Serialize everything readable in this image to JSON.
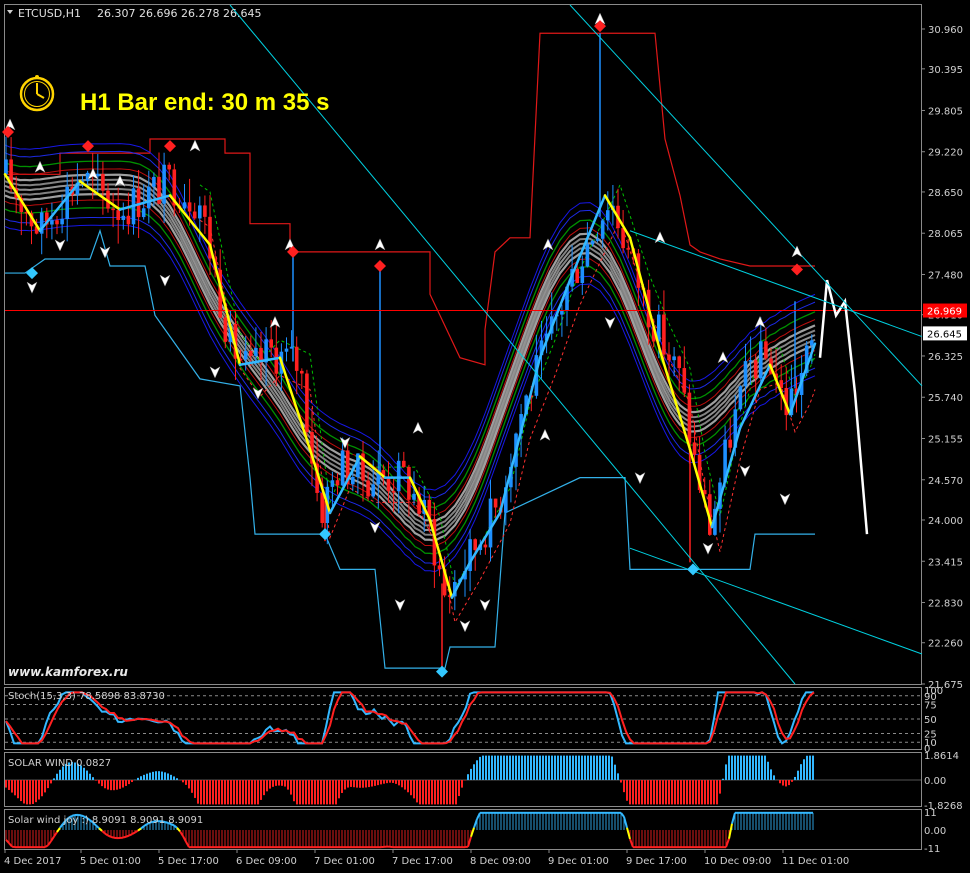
{
  "header": {
    "symbol_label": "ETCUSD,H1",
    "ohlc": "26.307 26.696 26.278 26.645",
    "timer_text": "H1 Bar end: 30 m 35 s",
    "watermark": "www.kamforex.ru"
  },
  "colors": {
    "background": "#000000",
    "grid": "#6c6c6c",
    "bull": "#1e90ff",
    "bear": "#ff2020",
    "timer_text": "#ffff00",
    "hline": "#ff0000",
    "trend": "#00d0e0"
  },
  "chart_data": [
    {
      "type": "candlestick",
      "symbol": "ETCUSD",
      "timeframe": "H1",
      "ylim": [
        21.675,
        31.3
      ],
      "y_ticks": [
        "30.960",
        "30.395",
        "29.805",
        "29.220",
        "28.650",
        "28.065",
        "27.480",
        "26.910",
        "26.325",
        "25.740",
        "25.155",
        "24.570",
        "24.000",
        "23.415",
        "22.830",
        "22.260",
        "21.675"
      ],
      "x_ticks": [
        "4 Dec 2017",
        "5 Dec 01:00",
        "5 Dec 17:00",
        "6 Dec 09:00",
        "7 Dec 01:00",
        "7 Dec 17:00",
        "8 Dec 09:00",
        "9 Dec 01:00",
        "9 Dec 17:00",
        "10 Dec 09:00",
        "11 Dec 01:00"
      ],
      "price_labels": [
        {
          "value": 26.969,
          "text": "26.969"
        },
        {
          "value": 26.645,
          "text": "26.645"
        }
      ],
      "price_anchors": [
        {
          "x": 5,
          "y": 28.9
        },
        {
          "x": 40,
          "y": 28.1
        },
        {
          "x": 80,
          "y": 28.9
        },
        {
          "x": 120,
          "y": 28.4
        },
        {
          "x": 170,
          "y": 28.8
        },
        {
          "x": 200,
          "y": 28.5
        },
        {
          "x": 230,
          "y": 26.5
        },
        {
          "x": 250,
          "y": 26.1
        },
        {
          "x": 270,
          "y": 26.4
        },
        {
          "x": 300,
          "y": 26.2
        },
        {
          "x": 320,
          "y": 24.1
        },
        {
          "x": 340,
          "y": 24.8
        },
        {
          "x": 365,
          "y": 24.6
        },
        {
          "x": 385,
          "y": 24.6
        },
        {
          "x": 405,
          "y": 24.6
        },
        {
          "x": 430,
          "y": 23.9
        },
        {
          "x": 445,
          "y": 22.9
        },
        {
          "x": 470,
          "y": 23.5
        },
        {
          "x": 500,
          "y": 24.3
        },
        {
          "x": 520,
          "y": 25.5
        },
        {
          "x": 545,
          "y": 26.4
        },
        {
          "x": 570,
          "y": 27.4
        },
        {
          "x": 600,
          "y": 28.3
        },
        {
          "x": 610,
          "y": 28.6
        },
        {
          "x": 640,
          "y": 27.3
        },
        {
          "x": 660,
          "y": 26.6
        },
        {
          "x": 680,
          "y": 26.0
        },
        {
          "x": 695,
          "y": 24.8
        },
        {
          "x": 710,
          "y": 23.9
        },
        {
          "x": 730,
          "y": 25.2
        },
        {
          "x": 750,
          "y": 26.2
        },
        {
          "x": 770,
          "y": 26.3
        },
        {
          "x": 785,
          "y": 25.6
        },
        {
          "x": 800,
          "y": 26.0
        },
        {
          "x": 815,
          "y": 26.6
        }
      ],
      "spikes": [
        {
          "x": 600,
          "y": 30.9
        },
        {
          "x": 442,
          "y": 21.8
        },
        {
          "x": 690,
          "y": 23.4
        },
        {
          "x": 380,
          "y": 27.6
        },
        {
          "x": 795,
          "y": 27.1
        },
        {
          "x": 325,
          "y": 23.7
        },
        {
          "x": 293,
          "y": 27.8
        }
      ],
      "upper_channel": [
        {
          "x": 5,
          "y": 28.9
        },
        {
          "x": 60,
          "y": 28.9
        },
        {
          "x": 60,
          "y": 29.2
        },
        {
          "x": 150,
          "y": 29.2
        },
        {
          "x": 150,
          "y": 29.4
        },
        {
          "x": 225,
          "y": 29.4
        },
        {
          "x": 225,
          "y": 29.2
        },
        {
          "x": 250,
          "y": 29.2
        },
        {
          "x": 250,
          "y": 28.2
        },
        {
          "x": 290,
          "y": 28.2
        },
        {
          "x": 290,
          "y": 27.8
        },
        {
          "x": 430,
          "y": 27.8
        },
        {
          "x": 430,
          "y": 27.2
        },
        {
          "x": 460,
          "y": 26.3
        },
        {
          "x": 485,
          "y": 26.2
        },
        {
          "x": 485,
          "y": 26.7
        },
        {
          "x": 495,
          "y": 27.8
        },
        {
          "x": 510,
          "y": 28.0
        },
        {
          "x": 530,
          "y": 28.0
        },
        {
          "x": 540,
          "y": 30.9
        },
        {
          "x": 655,
          "y": 30.9
        },
        {
          "x": 665,
          "y": 29.4
        },
        {
          "x": 680,
          "y": 28.6
        },
        {
          "x": 690,
          "y": 27.9
        },
        {
          "x": 700,
          "y": 27.8
        },
        {
          "x": 720,
          "y": 27.7
        },
        {
          "x": 750,
          "y": 27.6
        },
        {
          "x": 815,
          "y": 27.6
        }
      ],
      "lower_channel": [
        {
          "x": 5,
          "y": 27.5
        },
        {
          "x": 25,
          "y": 27.5
        },
        {
          "x": 45,
          "y": 27.7
        },
        {
          "x": 90,
          "y": 27.7
        },
        {
          "x": 100,
          "y": 28.1
        },
        {
          "x": 110,
          "y": 27.6
        },
        {
          "x": 145,
          "y": 27.6
        },
        {
          "x": 155,
          "y": 26.9
        },
        {
          "x": 200,
          "y": 26.0
        },
        {
          "x": 240,
          "y": 25.9
        },
        {
          "x": 250,
          "y": 24.6
        },
        {
          "x": 255,
          "y": 23.8
        },
        {
          "x": 325,
          "y": 23.8
        },
        {
          "x": 340,
          "y": 23.3
        },
        {
          "x": 375,
          "y": 23.3
        },
        {
          "x": 385,
          "y": 21.9
        },
        {
          "x": 445,
          "y": 21.9
        },
        {
          "x": 450,
          "y": 22.2
        },
        {
          "x": 495,
          "y": 22.2
        },
        {
          "x": 505,
          "y": 24.1
        },
        {
          "x": 580,
          "y": 24.6
        },
        {
          "x": 625,
          "y": 24.6
        },
        {
          "x": 630,
          "y": 23.3
        },
        {
          "x": 750,
          "y": 23.3
        },
        {
          "x": 755,
          "y": 23.8
        },
        {
          "x": 815,
          "y": 23.8
        }
      ],
      "moving_average_fast": [
        {
          "x": 5,
          "y": 28.9
        },
        {
          "x": 40,
          "y": 28.1
        },
        {
          "x": 80,
          "y": 28.8
        },
        {
          "x": 120,
          "y": 28.4
        },
        {
          "x": 170,
          "y": 28.6
        },
        {
          "x": 210,
          "y": 27.9
        },
        {
          "x": 240,
          "y": 26.2
        },
        {
          "x": 280,
          "y": 26.3
        },
        {
          "x": 310,
          "y": 25.0
        },
        {
          "x": 330,
          "y": 24.1
        },
        {
          "x": 360,
          "y": 24.9
        },
        {
          "x": 385,
          "y": 24.6
        },
        {
          "x": 410,
          "y": 24.6
        },
        {
          "x": 430,
          "y": 24.0
        },
        {
          "x": 452,
          "y": 22.9
        },
        {
          "x": 470,
          "y": 23.4
        },
        {
          "x": 500,
          "y": 24.1
        },
        {
          "x": 540,
          "y": 26.3
        },
        {
          "x": 570,
          "y": 27.4
        },
        {
          "x": 605,
          "y": 28.6
        },
        {
          "x": 630,
          "y": 28.0
        },
        {
          "x": 660,
          "y": 26.4
        },
        {
          "x": 690,
          "y": 25.0
        },
        {
          "x": 712,
          "y": 23.9
        },
        {
          "x": 740,
          "y": 25.3
        },
        {
          "x": 770,
          "y": 26.2
        },
        {
          "x": 790,
          "y": 25.5
        },
        {
          "x": 815,
          "y": 26.5
        }
      ],
      "signal_line": [
        {
          "x": 820,
          "y": 26.3
        },
        {
          "x": 827,
          "y": 27.4
        },
        {
          "x": 836,
          "y": 26.9
        },
        {
          "x": 845,
          "y": 27.1
        },
        {
          "x": 855,
          "y": 25.8
        },
        {
          "x": 867,
          "y": 23.8
        }
      ],
      "arrows_up": [
        {
          "x": 40,
          "y": 29.0
        },
        {
          "x": 120,
          "y": 28.8
        },
        {
          "x": 195,
          "y": 29.3
        },
        {
          "x": 290,
          "y": 27.9
        },
        {
          "x": 380,
          "y": 27.9
        },
        {
          "x": 548,
          "y": 27.9
        },
        {
          "x": 600,
          "y": 31.1
        },
        {
          "x": 660,
          "y": 28.0
        },
        {
          "x": 797,
          "y": 27.8
        },
        {
          "x": 760,
          "y": 26.8
        },
        {
          "x": 723,
          "y": 26.3
        },
        {
          "x": 418,
          "y": 25.3
        },
        {
          "x": 545,
          "y": 25.2
        },
        {
          "x": 275,
          "y": 26.8
        },
        {
          "x": 93,
          "y": 28.9
        },
        {
          "x": 10,
          "y": 29.6
        }
      ],
      "arrows_down": [
        {
          "x": 32,
          "y": 27.3
        },
        {
          "x": 60,
          "y": 27.9
        },
        {
          "x": 105,
          "y": 27.8
        },
        {
          "x": 165,
          "y": 27.4
        },
        {
          "x": 215,
          "y": 26.1
        },
        {
          "x": 258,
          "y": 25.8
        },
        {
          "x": 345,
          "y": 25.1
        },
        {
          "x": 375,
          "y": 23.9
        },
        {
          "x": 400,
          "y": 22.8
        },
        {
          "x": 465,
          "y": 22.5
        },
        {
          "x": 485,
          "y": 22.8
        },
        {
          "x": 708,
          "y": 23.6
        },
        {
          "x": 745,
          "y": 24.7
        },
        {
          "x": 785,
          "y": 24.3
        },
        {
          "x": 640,
          "y": 24.6
        },
        {
          "x": 610,
          "y": 26.8
        }
      ],
      "trend_lines": [
        {
          "x1": 230,
          "y1": 31.3,
          "x2": 795,
          "y2": 21.675
        },
        {
          "x1": 570,
          "y1": 31.3,
          "x2": 922,
          "y2": 25.9
        },
        {
          "x1": 630,
          "y1": 28.1,
          "x2": 922,
          "y2": 26.6
        },
        {
          "x1": 630,
          "y1": 23.6,
          "x2": 922,
          "y2": 22.1
        }
      ]
    },
    {
      "type": "line",
      "name": "Stoch(15,3,3)",
      "header_text": "Stoch(15,3,3) 78.5898 83.8730",
      "values": [
        78.5898,
        83.873
      ],
      "y_ticks": [
        "100",
        "90",
        "75",
        "50",
        "25",
        "10",
        "0"
      ],
      "ylim": [
        0,
        100
      ],
      "levels": [
        10,
        25,
        50,
        75,
        90
      ]
    },
    {
      "type": "bar",
      "name": "SOLAR WIND",
      "header_text": "SOLAR WIND 0.0827",
      "value": 0.0827,
      "y_ticks": [
        "1.8614",
        "0.00",
        "-1.8268"
      ],
      "ylim": [
        -1.8268,
        1.8614
      ]
    },
    {
      "type": "bar",
      "name": "Solar wind joy :)",
      "header_text": "Solar wind joy :) 8.9091 8.9091 8.9091",
      "values": [
        8.9091,
        8.9091,
        8.9091
      ],
      "y_ticks": [
        "11",
        "0.00",
        "-11"
      ],
      "ylim": [
        -11,
        11
      ]
    }
  ]
}
